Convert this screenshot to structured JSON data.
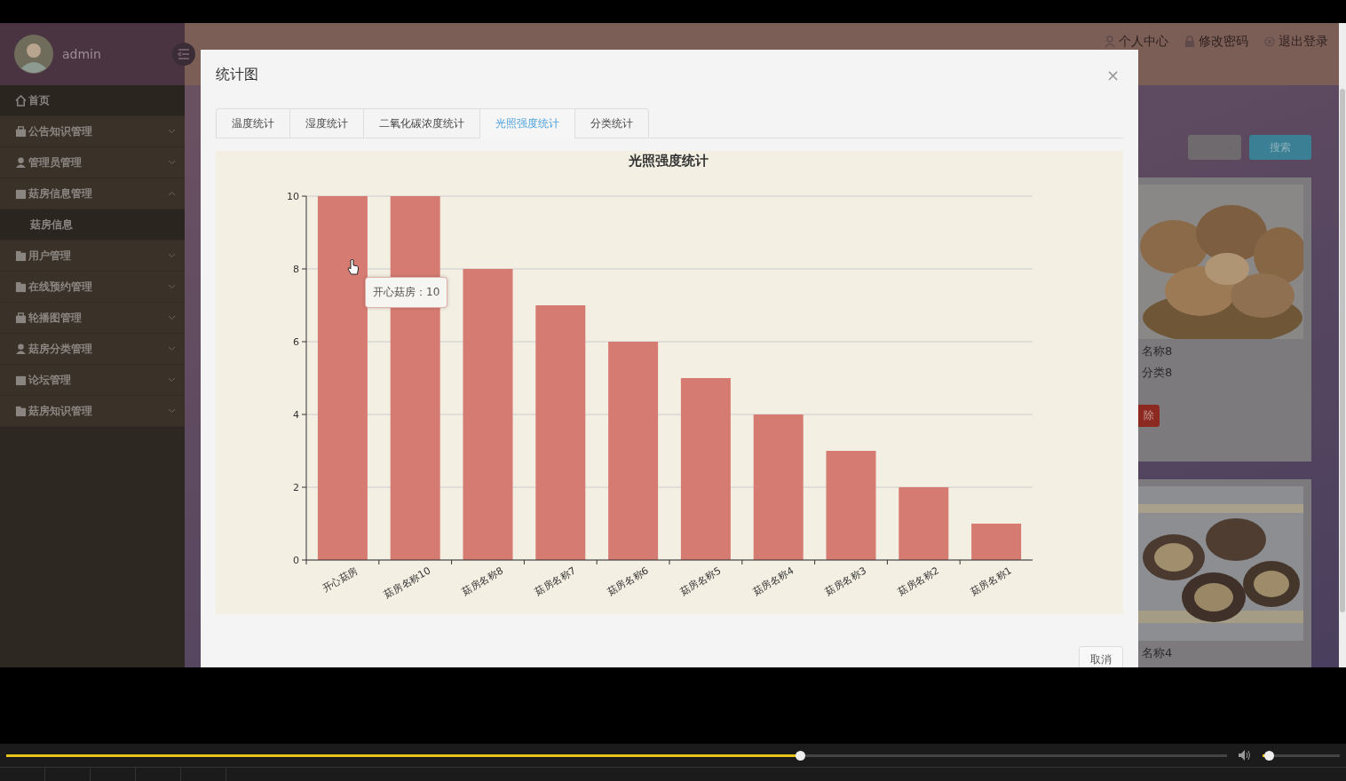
{
  "sidebar": {
    "user": "admin",
    "items": [
      {
        "label": "首页",
        "selected": true
      },
      {
        "label": "公告知识管理",
        "selected": false,
        "expanded": false
      },
      {
        "label": "管理员管理",
        "selected": false,
        "expanded": false
      },
      {
        "label": "菇房信息管理",
        "selected": false,
        "expanded": true,
        "children": [
          {
            "label": "菇房信息",
            "selected": false
          }
        ]
      },
      {
        "label": "用户管理",
        "selected": false,
        "expanded": false
      },
      {
        "label": "在线预约管理",
        "selected": false,
        "expanded": false
      },
      {
        "label": "轮播图管理",
        "selected": false,
        "expanded": false
      },
      {
        "label": "菇房分类管理",
        "selected": false,
        "expanded": false
      },
      {
        "label": "论坛管理",
        "selected": false,
        "expanded": false
      },
      {
        "label": "菇房知识管理",
        "selected": false,
        "expanded": false
      }
    ]
  },
  "header": {
    "links": [
      "个人中心",
      "修改密码",
      "退出登录"
    ]
  },
  "content": {
    "search_button": "搜索",
    "cards": [
      {
        "lines": [
          "名称8",
          "分类8"
        ],
        "button": "除"
      },
      {
        "lines": [
          "名称4"
        ]
      }
    ]
  },
  "modal": {
    "title": "统计图",
    "close": "×",
    "tabs": [
      {
        "label": "温度统计",
        "selected": false
      },
      {
        "label": "湿度统计",
        "selected": false
      },
      {
        "label": "二氧化碳浓度统计",
        "selected": false
      },
      {
        "label": "光照强度统计",
        "selected": true
      },
      {
        "label": "分类统计",
        "selected": false
      }
    ],
    "chart": {
      "tooltip": "开心菇房：10",
      "chart_data": {
        "type": "bar",
        "title": "光照强度统计",
        "categories": [
          "开心菇房",
          "菇房名称10",
          "菇房名称8",
          "菇房名称7",
          "菇房名称6",
          "菇房名称5",
          "菇房名称4",
          "菇房名称3",
          "菇房名称2",
          "菇房名称1"
        ],
        "grid": true,
        "series": [
          {
            "color": "#d67b72",
            "values": [
              10,
              10,
              8,
              7,
              6,
              5,
              4,
              3,
              2,
              1
            ]
          }
        ],
        "ylim": [
          0,
          10
        ],
        "yticks": [
          0,
          2,
          4,
          6,
          8,
          10
        ]
      }
    },
    "cancel_button": "取消"
  },
  "player": {
    "progress": {
      "level": 0.65
    },
    "volume": {
      "level": 0.08
    }
  }
}
